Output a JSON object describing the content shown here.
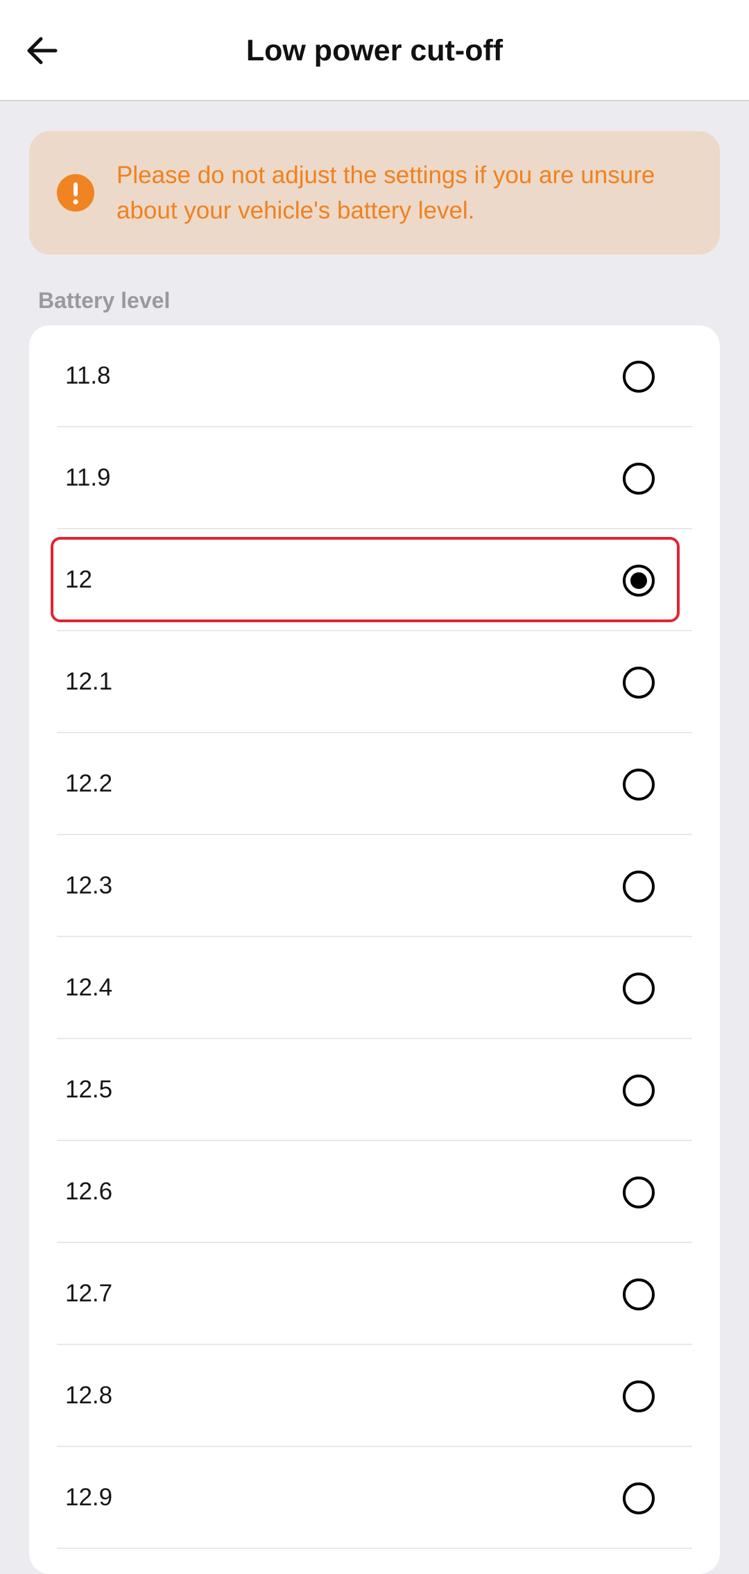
{
  "header": {
    "title": "Low power cut-off",
    "back_icon": "arrow-left-icon"
  },
  "warning": {
    "icon": "exclamation-circle-icon",
    "icon_symbol": "!",
    "text": "Please do not adjust the settings if you are unsure about your vehicle's battery level.",
    "color": "#EE8220",
    "background": "#EDD9C9"
  },
  "battery": {
    "section_label": "Battery level",
    "selected": "12",
    "options": [
      {
        "label": "11.8",
        "selected": false
      },
      {
        "label": "11.9",
        "selected": false
      },
      {
        "label": "12",
        "selected": true
      },
      {
        "label": "12.1",
        "selected": false
      },
      {
        "label": "12.2",
        "selected": false
      },
      {
        "label": "12.3",
        "selected": false
      },
      {
        "label": "12.4",
        "selected": false
      },
      {
        "label": "12.5",
        "selected": false
      },
      {
        "label": "12.6",
        "selected": false
      },
      {
        "label": "12.7",
        "selected": false
      },
      {
        "label": "12.8",
        "selected": false
      },
      {
        "label": "12.9",
        "selected": false
      }
    ]
  },
  "colors": {
    "background": "#ECEBF0",
    "highlight": "#E02434",
    "radio": "#000000"
  }
}
